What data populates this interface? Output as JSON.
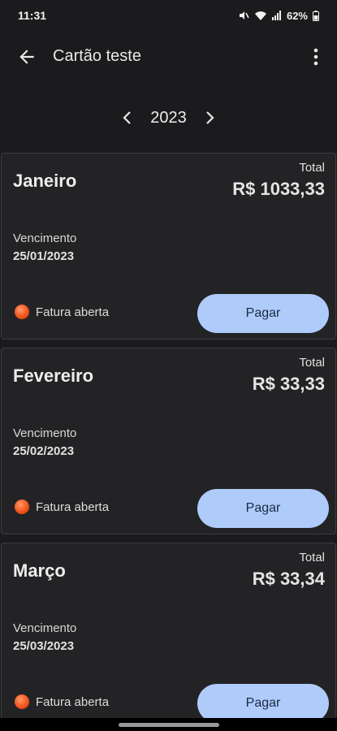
{
  "status_bar": {
    "time": "11:31",
    "battery": "62%"
  },
  "app_bar": {
    "title": "Cartão teste"
  },
  "year_nav": {
    "year": "2023"
  },
  "cards": [
    {
      "month": "Janeiro",
      "total_label": "Total",
      "total_value": "R$ 1033,33",
      "due_label": "Vencimento",
      "due_date": "25/01/2023",
      "status": "Fatura aberta",
      "button": "Pagar"
    },
    {
      "month": "Fevereiro",
      "total_label": "Total",
      "total_value": "R$ 33,33",
      "due_label": "Vencimento",
      "due_date": "25/02/2023",
      "status": "Fatura aberta",
      "button": "Pagar"
    },
    {
      "month": "Março",
      "total_label": "Total",
      "total_value": "R$ 33,34",
      "due_label": "Vencimento",
      "due_date": "25/03/2023",
      "status": "Fatura aberta",
      "button": "Pagar"
    }
  ],
  "colors": {
    "background": "#1b1b1d",
    "card": "#232325",
    "button": "#aecbfa",
    "status_dot": "#f2541c"
  }
}
